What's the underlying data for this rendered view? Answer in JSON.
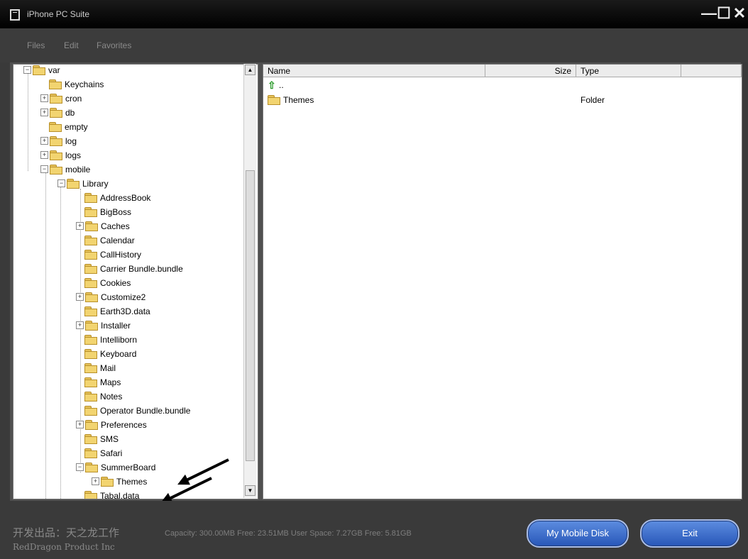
{
  "window": {
    "title": "iPhone PC Suite",
    "controls": {
      "minimize": "—",
      "maximize": "☐",
      "close": "✕"
    }
  },
  "menu": {
    "items": [
      "Files",
      "Edit",
      "Favorites"
    ]
  },
  "tree": {
    "items": [
      {
        "label": "var",
        "expander": "−"
      },
      {
        "label": "Keychains",
        "expander": ""
      },
      {
        "label": "cron",
        "expander": "+"
      },
      {
        "label": "db",
        "expander": "+"
      },
      {
        "label": "empty",
        "expander": ""
      },
      {
        "label": "log",
        "expander": "+"
      },
      {
        "label": "logs",
        "expander": "+"
      },
      {
        "label": "mobile",
        "expander": "−"
      },
      {
        "label": "Library",
        "expander": "−"
      },
      {
        "label": "AddressBook",
        "expander": ""
      },
      {
        "label": "BigBoss",
        "expander": ""
      },
      {
        "label": "Caches",
        "expander": "+"
      },
      {
        "label": "Calendar",
        "expander": ""
      },
      {
        "label": "CallHistory",
        "expander": ""
      },
      {
        "label": "Carrier Bundle.bundle",
        "expander": ""
      },
      {
        "label": "Cookies",
        "expander": ""
      },
      {
        "label": "Customize2",
        "expander": "+"
      },
      {
        "label": "Earth3D.data",
        "expander": ""
      },
      {
        "label": "Installer",
        "expander": "+"
      },
      {
        "label": "Intelliborn",
        "expander": ""
      },
      {
        "label": "Keyboard",
        "expander": ""
      },
      {
        "label": "Mail",
        "expander": ""
      },
      {
        "label": "Maps",
        "expander": ""
      },
      {
        "label": "Notes",
        "expander": ""
      },
      {
        "label": "Operator Bundle.bundle",
        "expander": ""
      },
      {
        "label": "Preferences",
        "expander": "+"
      },
      {
        "label": "SMS",
        "expander": ""
      },
      {
        "label": "Safari",
        "expander": ""
      },
      {
        "label": "SummerBoard",
        "expander": "−"
      },
      {
        "label": "Themes",
        "expander": "+"
      },
      {
        "label": "Tabal.data",
        "expander": ""
      }
    ],
    "scroll_up": "▲",
    "scroll_down": "▼"
  },
  "list": {
    "columns": {
      "name": "Name",
      "size": "Size",
      "type": "Type"
    },
    "up_entry": {
      "name": ".."
    },
    "rows": [
      {
        "name": "Themes",
        "size": "",
        "type": "Folder"
      }
    ]
  },
  "status": {
    "brand_line1": "开发出品：天之龙工作",
    "brand_line2": "RedDragon Product Inc",
    "capacity": "Capacity: 300.00MB Free: 23.51MB User Space: 7.27GB Free: 5.81GB"
  },
  "buttons": {
    "mobile_disk": "My Mobile Disk",
    "exit": "Exit"
  },
  "colors": {
    "button_blue": "#2756b8",
    "folder_yellow": "#f2d470"
  }
}
